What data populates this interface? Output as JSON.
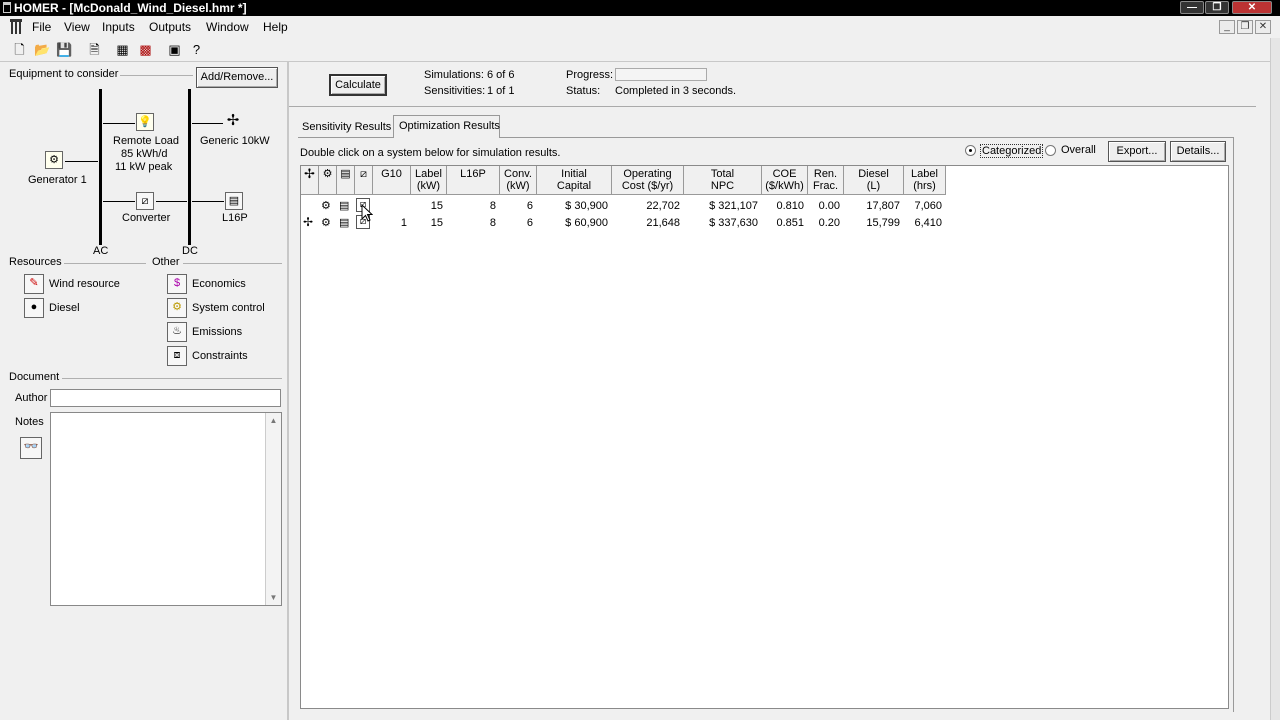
{
  "window": {
    "title": "HOMER - [McDonald_Wind_Diesel.hmr *]",
    "min": "—",
    "max": "❐",
    "close": "✕"
  },
  "menu": {
    "items": [
      "File",
      "View",
      "Inputs",
      "Outputs",
      "Window",
      "Help"
    ]
  },
  "left": {
    "equipment_label": "Equipment to consider",
    "add_remove": "Add/Remove...",
    "components": {
      "remote_load": {
        "name": "Remote Load",
        "kwh": "85 kWh/d",
        "peak": "11 kW peak"
      },
      "generator": "Generator 1",
      "wind": "Generic 10kW",
      "converter": "Converter",
      "battery": "L16P",
      "ac": "AC",
      "dc": "DC"
    },
    "resources_label": "Resources",
    "other_label": "Other",
    "resources": [
      "Wind resource",
      "Diesel"
    ],
    "other": [
      "Economics",
      "System control",
      "Emissions",
      "Constraints"
    ],
    "document_label": "Document",
    "author_label": "Author",
    "author_value": "",
    "notes_label": "Notes"
  },
  "top": {
    "calculate": "Calculate",
    "simulations_label": "Simulations:",
    "simulations_value": "6 of 6",
    "sensitivities_label": "Sensitivities:",
    "sensitivities_value": "1 of 1",
    "progress_label": "Progress:",
    "status_label": "Status:",
    "status_value": "Completed in 3 seconds."
  },
  "tabs": [
    "Sensitivity Results",
    "Optimization Results"
  ],
  "results": {
    "hint": "Double click on a system below for simulation results.",
    "radio_categorized": "Categorized",
    "radio_overall": "Overall",
    "export": "Export...",
    "details": "Details...",
    "headers": [
      [
        "G10",
        ""
      ],
      [
        "Label",
        "(kW)"
      ],
      [
        "L16P",
        ""
      ],
      [
        "Conv.",
        "(kW)"
      ],
      [
        "Initial",
        "Capital"
      ],
      [
        "Operating",
        "Cost ($/yr)"
      ],
      [
        "Total",
        "NPC"
      ],
      [
        "COE",
        "($/kWh)"
      ],
      [
        "Ren.",
        "Frac."
      ],
      [
        "Diesel",
        "(L)"
      ],
      [
        "Label",
        "(hrs)"
      ]
    ],
    "rows": [
      [
        "",
        "15",
        "8",
        "6",
        "$ 30,900",
        "22,702",
        "$ 321,107",
        "0.810",
        "0.00",
        "17,807",
        "7,060"
      ],
      [
        "1",
        "15",
        "8",
        "6",
        "$ 60,900",
        "21,648",
        "$ 337,630",
        "0.851",
        "0.20",
        "15,799",
        "6,410"
      ]
    ]
  }
}
